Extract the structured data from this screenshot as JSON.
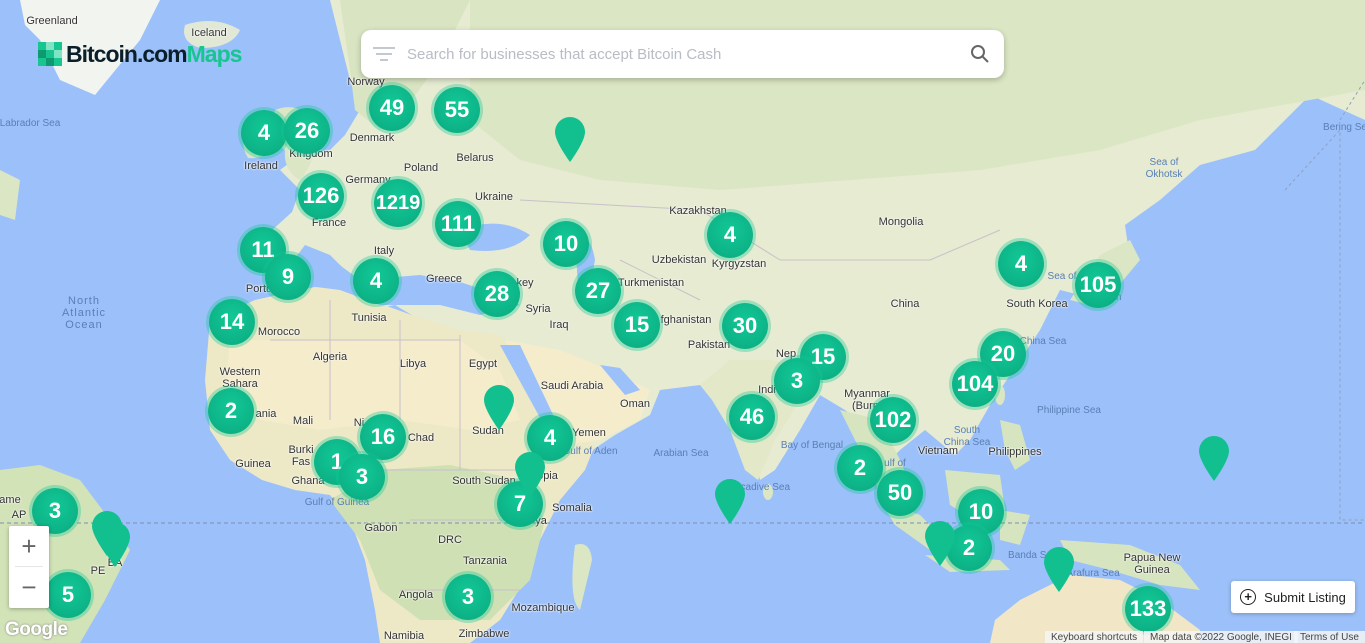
{
  "header": {
    "logo_text": "Bitcoin.com",
    "logo_maps": "Maps"
  },
  "search": {
    "placeholder": "Search for businesses that accept Bitcoin Cash"
  },
  "controls": {
    "zoom_in": "+",
    "zoom_out": "−",
    "submit_label": "Submit Listing"
  },
  "footer": {
    "google_logo": "Google",
    "keyboard_shortcuts": "Keyboard shortcuts",
    "map_data": "Map data ©2022 Google, INEGI",
    "terms": "Terms of Use"
  },
  "colors": {
    "accent": "#17c590",
    "water": "#9cc0f9",
    "land": "#e8ecd8"
  },
  "labels": [
    {
      "text": "Greenland",
      "kind": "land"
    },
    {
      "text": "Iceland",
      "kind": "land"
    },
    {
      "text": "Norway",
      "kind": "land"
    },
    {
      "text": "Denmark",
      "kind": "land"
    },
    {
      "text": "Ireland",
      "kind": "land"
    },
    {
      "text": "Kingdom",
      "kind": "land"
    },
    {
      "text": "Germany",
      "kind": "land"
    },
    {
      "text": "Poland",
      "kind": "land"
    },
    {
      "text": "Belarus",
      "kind": "land"
    },
    {
      "text": "Ukraine",
      "kind": "land"
    },
    {
      "text": "France",
      "kind": "land"
    },
    {
      "text": "Italy",
      "kind": "land"
    },
    {
      "text": "Greece",
      "kind": "land"
    },
    {
      "text": "Portu",
      "kind": "land"
    },
    {
      "text": "Tunisia",
      "kind": "land"
    },
    {
      "text": "Morocco",
      "kind": "land"
    },
    {
      "text": "Algeria",
      "kind": "land"
    },
    {
      "text": "Libya",
      "kind": "land"
    },
    {
      "text": "Egypt",
      "kind": "land"
    },
    {
      "text": "Western\nSahara",
      "kind": "land"
    },
    {
      "text": "Mali",
      "kind": "land"
    },
    {
      "text": "Chad",
      "kind": "land"
    },
    {
      "text": "Guinea",
      "kind": "land"
    },
    {
      "text": "Ghana",
      "kind": "land"
    },
    {
      "text": "Gabon",
      "kind": "land"
    },
    {
      "text": "DRC",
      "kind": "land"
    },
    {
      "text": "Tanzania",
      "kind": "land"
    },
    {
      "text": "Angola",
      "kind": "land"
    },
    {
      "text": "Mozambique",
      "kind": "land"
    },
    {
      "text": "Namibia",
      "kind": "land"
    },
    {
      "text": "Zimbabwe",
      "kind": "land"
    },
    {
      "text": "Sudan",
      "kind": "land"
    },
    {
      "text": "South Sudan",
      "kind": "land"
    },
    {
      "text": "Ethiopia",
      "kind": "land"
    },
    {
      "text": "Somalia",
      "kind": "land"
    },
    {
      "text": "Yemen",
      "kind": "land"
    },
    {
      "text": "Oman",
      "kind": "land"
    },
    {
      "text": "Saudi Arabia",
      "kind": "land"
    },
    {
      "text": "Iraq",
      "kind": "land"
    },
    {
      "text": "Syria",
      "kind": "land"
    },
    {
      "text": "key",
      "kind": "land"
    },
    {
      "text": "Turkmenistan",
      "kind": "land"
    },
    {
      "text": "Uzbekistan",
      "kind": "land"
    },
    {
      "text": "Kazakhstan",
      "kind": "land"
    },
    {
      "text": "Kyrgyzstan",
      "kind": "land"
    },
    {
      "text": "fghanistan",
      "kind": "land"
    },
    {
      "text": "Pakistan",
      "kind": "land"
    },
    {
      "text": "Indi",
      "kind": "land"
    },
    {
      "text": "Nep",
      "kind": "land"
    },
    {
      "text": "China",
      "kind": "land"
    },
    {
      "text": "Mongolia",
      "kind": "land"
    },
    {
      "text": "South Korea",
      "kind": "land"
    },
    {
      "text": "Myanmar\n(Burm",
      "kind": "land"
    },
    {
      "text": "Vietnam",
      "kind": "land"
    },
    {
      "text": "Philippines",
      "kind": "land"
    },
    {
      "text": "Papua New\nGuinea",
      "kind": "land"
    },
    {
      "text": "ania",
      "kind": "land"
    },
    {
      "text": "Burki\nFas",
      "kind": "land"
    },
    {
      "text": "Ni",
      "kind": "land"
    },
    {
      "text": "ya",
      "kind": "land"
    },
    {
      "text": "ame",
      "kind": "land"
    },
    {
      "text": "AP",
      "kind": "land"
    },
    {
      "text": "PE",
      "kind": "land"
    },
    {
      "text": "BA",
      "kind": "land"
    },
    {
      "text": "Labrador Sea",
      "kind": "water"
    },
    {
      "text": "Bering Se",
      "kind": "water"
    },
    {
      "text": "Sea of\nOkhotsk",
      "kind": "water"
    },
    {
      "text": "Sea of",
      "kind": "water"
    },
    {
      "text": "an",
      "kind": "water"
    },
    {
      "text": "China Sea",
      "kind": "water"
    },
    {
      "text": "Philippine Sea",
      "kind": "water"
    },
    {
      "text": "South\nChina Sea",
      "kind": "water"
    },
    {
      "text": "Bay of Bengal",
      "kind": "water"
    },
    {
      "text": "Arabian Sea",
      "kind": "water"
    },
    {
      "text": "Gulf of Aden",
      "kind": "water"
    },
    {
      "text": "Gulf of Guinea",
      "kind": "water"
    },
    {
      "text": "Banda Se",
      "kind": "water"
    },
    {
      "text": "Arafura Sea",
      "kind": "water"
    },
    {
      "text": "accadive Sea",
      "kind": "water"
    },
    {
      "text": "ulf of",
      "kind": "water"
    },
    {
      "text": "North\nAtlantic\nOcean",
      "kind": "ocean"
    }
  ],
  "clusters": [
    {
      "count": "4"
    },
    {
      "count": "26"
    },
    {
      "count": "49"
    },
    {
      "count": "55"
    },
    {
      "count": "126"
    },
    {
      "count": "1219"
    },
    {
      "count": "111"
    },
    {
      "count": "11"
    },
    {
      "count": "9"
    },
    {
      "count": "4"
    },
    {
      "count": "14"
    },
    {
      "count": "28"
    },
    {
      "count": "10"
    },
    {
      "count": "27"
    },
    {
      "count": "15"
    },
    {
      "count": "4"
    },
    {
      "count": "30"
    },
    {
      "count": "15"
    },
    {
      "count": "3"
    },
    {
      "count": "46"
    },
    {
      "count": "4"
    },
    {
      "count": "105"
    },
    {
      "count": "20"
    },
    {
      "count": "104"
    },
    {
      "count": "102"
    },
    {
      "count": "2"
    },
    {
      "count": "50"
    },
    {
      "count": "2"
    },
    {
      "count": "16"
    },
    {
      "count": "1"
    },
    {
      "count": "3"
    },
    {
      "count": "4"
    },
    {
      "count": "7"
    },
    {
      "count": "3"
    },
    {
      "count": "10"
    },
    {
      "count": "2"
    },
    {
      "count": "133"
    },
    {
      "count": "3"
    },
    {
      "count": "5"
    }
  ],
  "pins": [
    {
      "name": "russia-pin"
    },
    {
      "name": "sudan-pin"
    },
    {
      "name": "maldives-pin"
    },
    {
      "name": "pacific-pin"
    },
    {
      "name": "java-pin"
    },
    {
      "name": "timor-pin"
    },
    {
      "name": "brazil-pin"
    },
    {
      "name": "brazil-pin-2"
    },
    {
      "name": "kenya-pin"
    }
  ]
}
